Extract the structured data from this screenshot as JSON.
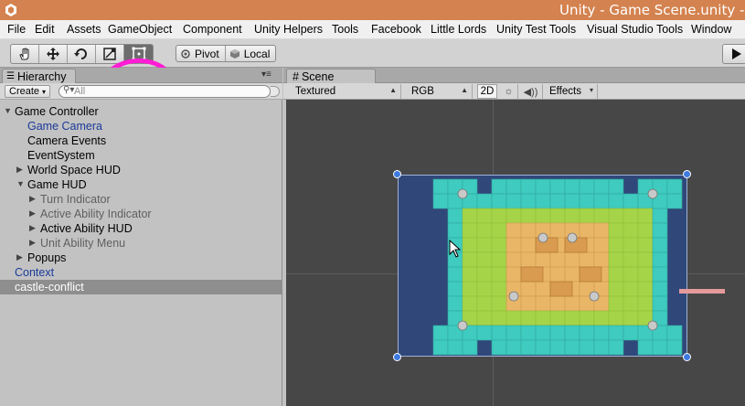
{
  "window": {
    "title": "Unity - Game Scene.unity - Littl"
  },
  "menu": [
    "File",
    "Edit",
    "Assets",
    "GameObject",
    "Component",
    "Unity Helpers",
    "Tools",
    "Facebook",
    "Little Lords",
    "Unity Test Tools",
    "Visual Studio Tools",
    "Window"
  ],
  "toolbar": {
    "tools": [
      "hand-tool",
      "move-tool",
      "rotate-tool",
      "scale-tool",
      "rect-tool"
    ],
    "active_tool": "rect-tool",
    "pivot_label": "Pivot",
    "local_label": "Local",
    "highlight_color": "#ff1cd4"
  },
  "hierarchy": {
    "tab_label": "Hierarchy",
    "create_label": "Create",
    "search_placeholder": "All",
    "items": [
      {
        "label": "Game Controller",
        "depth": 0,
        "arrow": "expanded",
        "style": "normal"
      },
      {
        "label": "Game Camera",
        "depth": 1,
        "arrow": "none",
        "style": "blue"
      },
      {
        "label": "Camera Events",
        "depth": 1,
        "arrow": "none",
        "style": "normal"
      },
      {
        "label": "EventSystem",
        "depth": 1,
        "arrow": "none",
        "style": "normal"
      },
      {
        "label": "World Space HUD",
        "depth": 1,
        "arrow": "collapsed",
        "style": "normal"
      },
      {
        "label": "Game HUD",
        "depth": 1,
        "arrow": "expanded",
        "style": "normal"
      },
      {
        "label": "Turn Indicator",
        "depth": 2,
        "arrow": "collapsed",
        "style": "dim"
      },
      {
        "label": "Active Ability Indicator",
        "depth": 2,
        "arrow": "collapsed",
        "style": "dim"
      },
      {
        "label": "Active Ability HUD",
        "depth": 2,
        "arrow": "collapsed",
        "style": "normal"
      },
      {
        "label": "Unit Ability Menu",
        "depth": 2,
        "arrow": "collapsed",
        "style": "dim"
      },
      {
        "label": "Popups",
        "depth": 1,
        "arrow": "collapsed",
        "style": "normal"
      },
      {
        "label": "Context",
        "depth": 0,
        "arrow": "none",
        "style": "blue"
      },
      {
        "label": "castle-conflict",
        "depth": 0,
        "arrow": "none",
        "style": "selected"
      }
    ]
  },
  "scene": {
    "tab_label": "Scene",
    "render_mode": "Textured",
    "color_mode": "RGB",
    "mode_2d_label": "2D",
    "effects_label": "Effects"
  },
  "colors": {
    "titlebar": "#d4824f",
    "canvas_bg": "#30477a",
    "water": "#3fcbbf",
    "grass": "#a6d449",
    "sand": "#e9b667",
    "handle": "#3d7ae0"
  }
}
